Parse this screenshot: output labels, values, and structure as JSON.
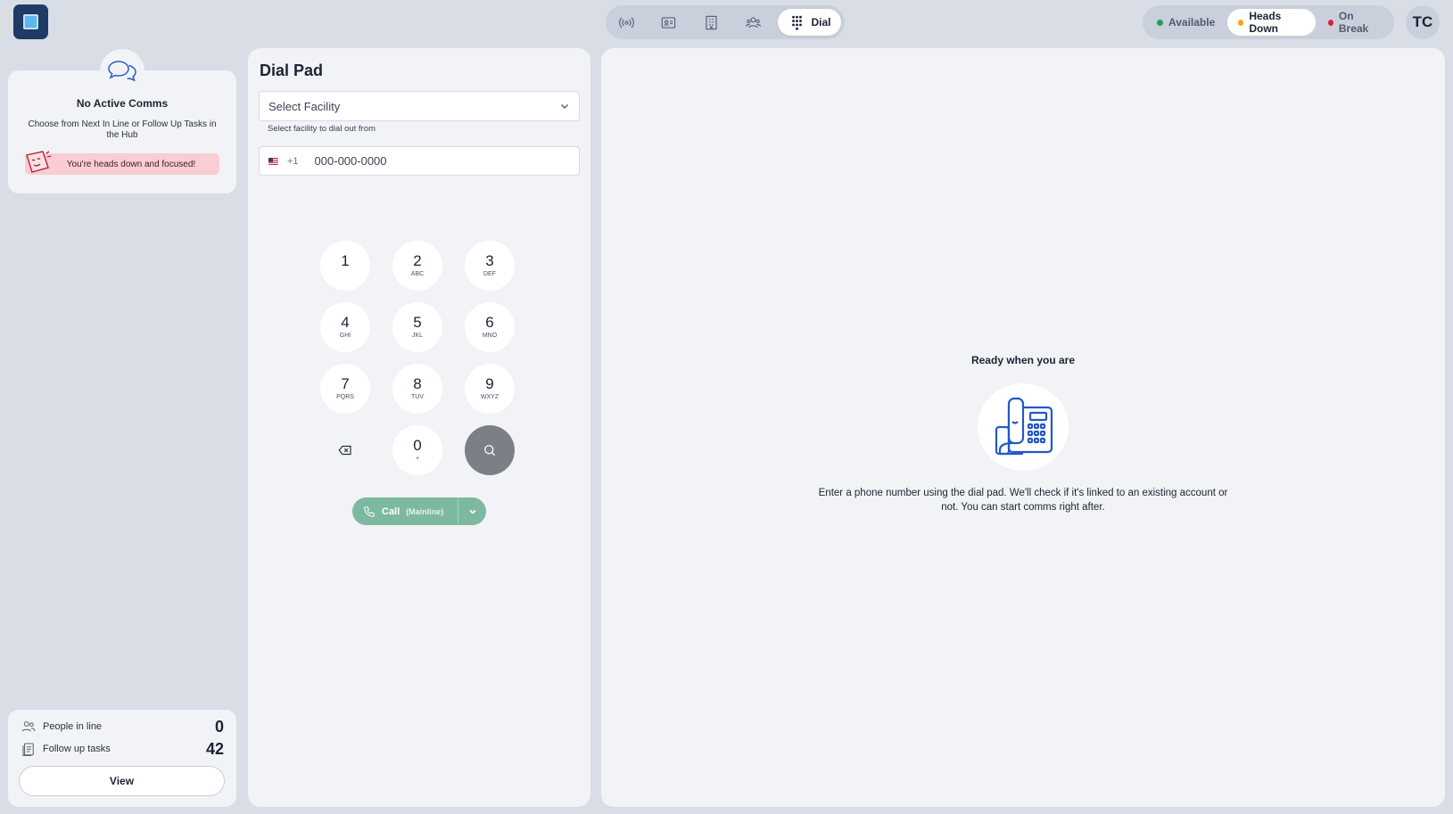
{
  "nav": {
    "icons": [
      "broadcast-icon",
      "contact-card-icon",
      "building-icon",
      "team-icon"
    ],
    "active_label": "Dial"
  },
  "status": {
    "options": [
      {
        "label": "Available",
        "color": "#1aa05a"
      },
      {
        "label": "Heads Down",
        "color": "#f3a712"
      },
      {
        "label": "On Break",
        "color": "#e0203a"
      }
    ],
    "active": "Heads Down"
  },
  "user": {
    "initials": "TC"
  },
  "comms": {
    "title": "No Active Comms",
    "subtitle": "Choose from Next In Line or Follow Up Tasks in the Hub",
    "banner": "You're heads down and focused!"
  },
  "queue": {
    "people_label": "People in line",
    "people_count": "0",
    "tasks_label": "Follow up tasks",
    "tasks_count": "42",
    "view_label": "View"
  },
  "dialpad": {
    "title": "Dial Pad",
    "facility_placeholder": "Select Facility",
    "facility_hint": "Select facility to dial out from",
    "country_code": "+1",
    "phone_placeholder": "000-000-0000",
    "keys": [
      {
        "digit": "1",
        "letters": ""
      },
      {
        "digit": "2",
        "letters": "ABC"
      },
      {
        "digit": "3",
        "letters": "DEF"
      },
      {
        "digit": "4",
        "letters": "GHI"
      },
      {
        "digit": "5",
        "letters": "JKL"
      },
      {
        "digit": "6",
        "letters": "MNO"
      },
      {
        "digit": "7",
        "letters": "PQRS"
      },
      {
        "digit": "8",
        "letters": "TUV"
      },
      {
        "digit": "9",
        "letters": "WXYZ"
      },
      {
        "digit": "0",
        "letters": "+"
      }
    ],
    "call_label": "Call",
    "call_line": "(Mainline)"
  },
  "main": {
    "title": "Ready when you are",
    "description": "Enter a phone number using the dial pad. We'll check if it's linked to an existing account or not. You can start comms right after."
  },
  "colors": {
    "accent": "#1d3b66",
    "call": "#7db9a0",
    "banner": "#f9cdd2"
  }
}
